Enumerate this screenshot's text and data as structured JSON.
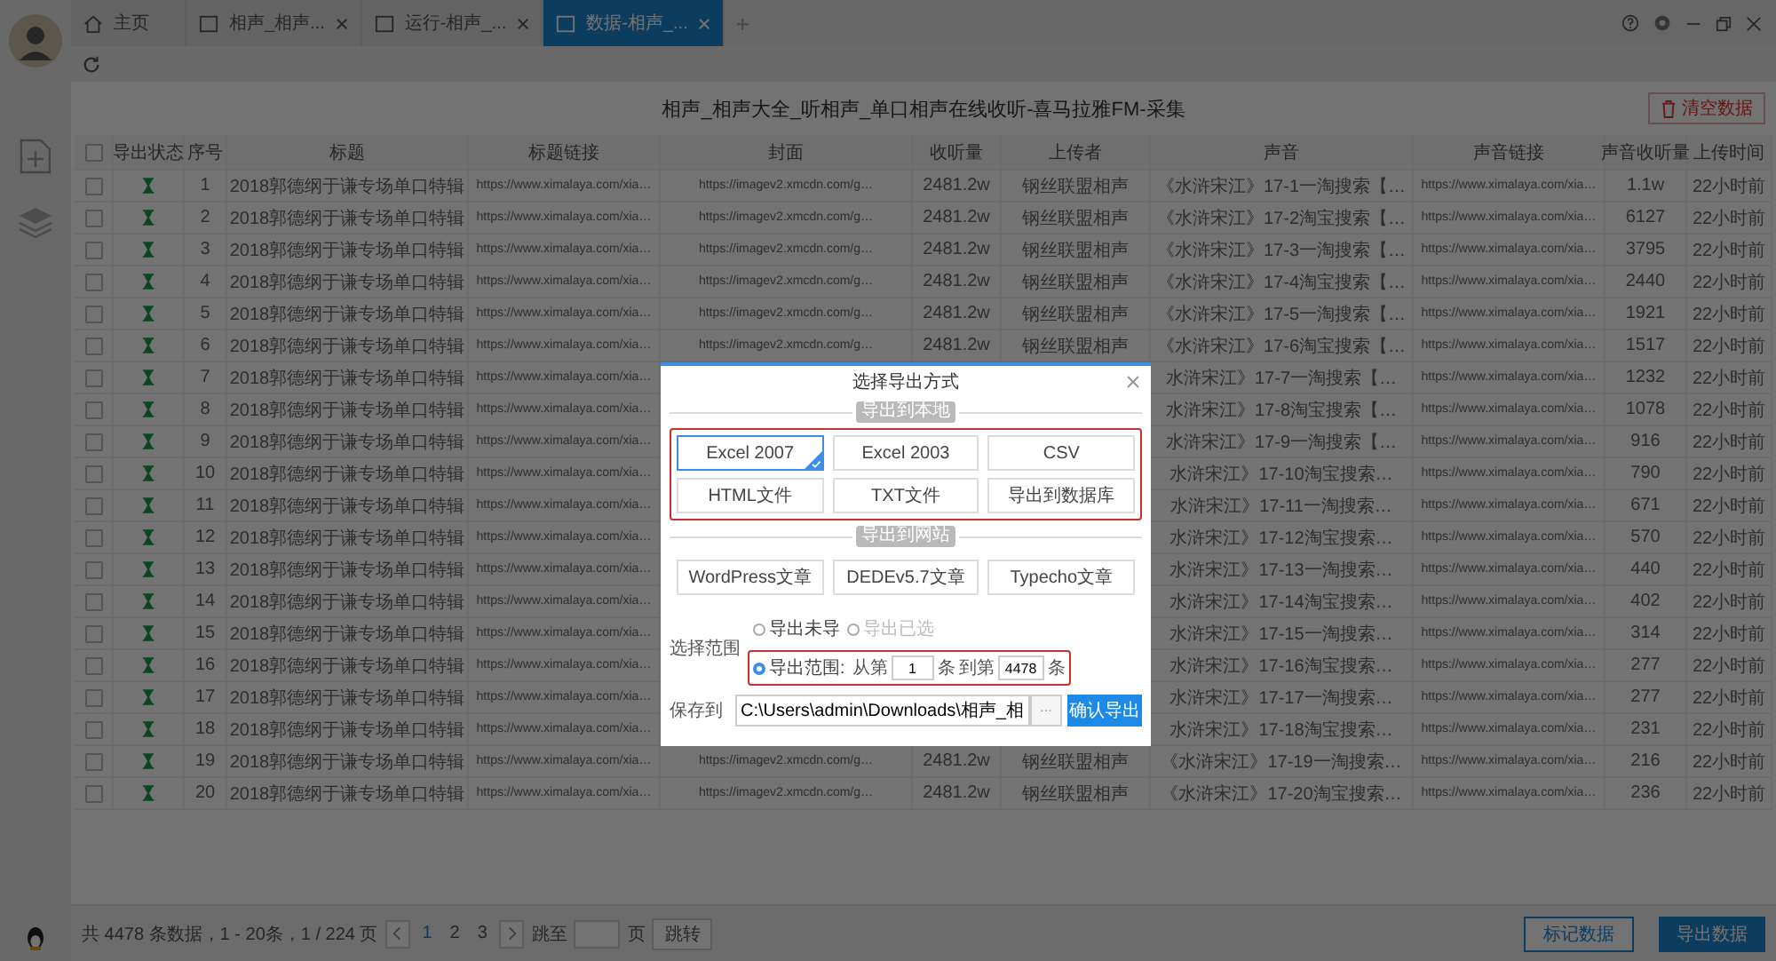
{
  "tabs": [
    {
      "label": "主页",
      "kind": "home",
      "selected": false,
      "closable": false
    },
    {
      "label": "相声_相声...",
      "kind": "page",
      "selected": false,
      "closable": true
    },
    {
      "label": "运行-相声_...",
      "kind": "page",
      "selected": false,
      "closable": true
    },
    {
      "label": "数据-相声_...",
      "kind": "page",
      "selected": true,
      "closable": true
    }
  ],
  "add_tab": "+",
  "page_title": "相声_相声大全_听相声_单口相声在线收听-喜马拉雅FM-采集",
  "clear_button": "清空数据",
  "table": {
    "header_checked": false,
    "status_header": "导出状态",
    "columns": [
      "序号",
      "标题",
      "标题链接",
      "封面",
      "收听量",
      "上传者",
      "声音",
      "声音链接",
      "声音收听量",
      "上传时间"
    ],
    "rows": [
      {
        "checked": false,
        "cells": [
          "1",
          "2018郭德纲于谦专场单口特辑",
          "https://www.ximalaya.com/xia…",
          "https://imagev2.xmcdn.com/g…",
          "2481.2w",
          "钢丝联盟相声",
          "《水浒宋江》17-1一淘搜索【…",
          "https://www.ximalaya.com/xia…",
          "1.1w",
          "22小时前"
        ]
      },
      {
        "checked": false,
        "cells": [
          "2",
          "2018郭德纲于谦专场单口特辑",
          "https://www.ximalaya.com/xia…",
          "https://imagev2.xmcdn.com/g…",
          "2481.2w",
          "钢丝联盟相声",
          "《水浒宋江》17-2淘宝搜索【…",
          "https://www.ximalaya.com/xia…",
          "6127",
          "22小时前"
        ]
      },
      {
        "checked": false,
        "cells": [
          "3",
          "2018郭德纲于谦专场单口特辑",
          "https://www.ximalaya.com/xia…",
          "https://imagev2.xmcdn.com/g…",
          "2481.2w",
          "钢丝联盟相声",
          "《水浒宋江》17-3一淘搜索【…",
          "https://www.ximalaya.com/xia…",
          "3795",
          "22小时前"
        ]
      },
      {
        "checked": false,
        "cells": [
          "4",
          "2018郭德纲于谦专场单口特辑",
          "https://www.ximalaya.com/xia…",
          "https://imagev2.xmcdn.com/g…",
          "2481.2w",
          "钢丝联盟相声",
          "《水浒宋江》17-4淘宝搜索【…",
          "https://www.ximalaya.com/xia…",
          "2440",
          "22小时前"
        ]
      },
      {
        "checked": false,
        "cells": [
          "5",
          "2018郭德纲于谦专场单口特辑",
          "https://www.ximalaya.com/xia…",
          "https://imagev2.xmcdn.com/g…",
          "2481.2w",
          "钢丝联盟相声",
          "《水浒宋江》17-5一淘搜索【…",
          "https://www.ximalaya.com/xia…",
          "1921",
          "22小时前"
        ]
      },
      {
        "checked": false,
        "cells": [
          "6",
          "2018郭德纲于谦专场单口特辑",
          "https://www.ximalaya.com/xia…",
          "https://imagev2.xmcdn.com/g…",
          "2481.2w",
          "钢丝联盟相声",
          "《水浒宋江》17-6淘宝搜索【…",
          "https://www.ximalaya.com/xia…",
          "1517",
          "22小时前"
        ]
      },
      {
        "checked": false,
        "cells": [
          "7",
          "2018郭德纲于谦专场单口特辑",
          "https://www.ximalaya.com/xia…",
          null,
          null,
          null,
          "水浒宋江》17-7一淘搜索【…",
          "https://www.ximalaya.com/xia…",
          "1232",
          "22小时前"
        ]
      },
      {
        "checked": false,
        "cells": [
          "8",
          "2018郭德纲于谦专场单口特辑",
          "https://www.ximalaya.com/xia…",
          null,
          null,
          null,
          "水浒宋江》17-8淘宝搜索【…",
          "https://www.ximalaya.com/xia…",
          "1078",
          "22小时前"
        ]
      },
      {
        "checked": false,
        "cells": [
          "9",
          "2018郭德纲于谦专场单口特辑",
          "https://www.ximalaya.com/xia…",
          null,
          null,
          null,
          "水浒宋江》17-9一淘搜索【…",
          "https://www.ximalaya.com/xia…",
          "916",
          "22小时前"
        ]
      },
      {
        "checked": false,
        "cells": [
          "10",
          "2018郭德纲于谦专场单口特辑",
          "https://www.ximalaya.com/xia…",
          null,
          null,
          null,
          "水浒宋江》17-10淘宝搜索…",
          "https://www.ximalaya.com/xia…",
          "790",
          "22小时前"
        ]
      },
      {
        "checked": false,
        "cells": [
          "11",
          "2018郭德纲于谦专场单口特辑",
          "https://www.ximalaya.com/xia…",
          null,
          null,
          null,
          "水浒宋江》17-11一淘搜索…",
          "https://www.ximalaya.com/xia…",
          "671",
          "22小时前"
        ]
      },
      {
        "checked": false,
        "cells": [
          "12",
          "2018郭德纲于谦专场单口特辑",
          "https://www.ximalaya.com/xia…",
          null,
          null,
          null,
          "水浒宋江》17-12淘宝搜索…",
          "https://www.ximalaya.com/xia…",
          "570",
          "22小时前"
        ]
      },
      {
        "checked": false,
        "cells": [
          "13",
          "2018郭德纲于谦专场单口特辑",
          "https://www.ximalaya.com/xia…",
          null,
          null,
          null,
          "水浒宋江》17-13一淘搜索…",
          "https://www.ximalaya.com/xia…",
          "440",
          "22小时前"
        ]
      },
      {
        "checked": false,
        "cells": [
          "14",
          "2018郭德纲于谦专场单口特辑",
          "https://www.ximalaya.com/xia…",
          null,
          null,
          null,
          "水浒宋江》17-14淘宝搜索…",
          "https://www.ximalaya.com/xia…",
          "402",
          "22小时前"
        ]
      },
      {
        "checked": false,
        "cells": [
          "15",
          "2018郭德纲于谦专场单口特辑",
          "https://www.ximalaya.com/xia…",
          null,
          null,
          null,
          "水浒宋江》17-15一淘搜索…",
          "https://www.ximalaya.com/xia…",
          "314",
          "22小时前"
        ]
      },
      {
        "checked": false,
        "cells": [
          "16",
          "2018郭德纲于谦专场单口特辑",
          "https://www.ximalaya.com/xia…",
          null,
          null,
          null,
          "水浒宋江》17-16淘宝搜索…",
          "https://www.ximalaya.com/xia…",
          "277",
          "22小时前"
        ]
      },
      {
        "checked": false,
        "cells": [
          "17",
          "2018郭德纲于谦专场单口特辑",
          "https://www.ximalaya.com/xia…",
          null,
          null,
          null,
          "水浒宋江》17-17一淘搜索…",
          "https://www.ximalaya.com/xia…",
          "277",
          "22小时前"
        ]
      },
      {
        "checked": false,
        "cells": [
          "18",
          "2018郭德纲于谦专场单口特辑",
          "https://www.ximalaya.com/xia…",
          null,
          null,
          null,
          "水浒宋江》17-18淘宝搜索…",
          "https://www.ximalaya.com/xia…",
          "231",
          "22小时前"
        ]
      },
      {
        "checked": false,
        "cells": [
          "19",
          "2018郭德纲于谦专场单口特辑",
          "https://www.ximalaya.com/xia…",
          "https://imagev2.xmcdn.com/g…",
          "2481.2w",
          "钢丝联盟相声",
          "《水浒宋江》17-19一淘搜索…",
          "https://www.ximalaya.com/xia…",
          "216",
          "22小时前"
        ]
      },
      {
        "checked": false,
        "cells": [
          "20",
          "2018郭德纲于谦专场单口特辑",
          "https://www.ximalaya.com/xia…",
          "https://imagev2.xmcdn.com/g…",
          "2481.2w",
          "钢丝联盟相声",
          "《水浒宋江》17-20淘宝搜索…",
          "https://www.ximalaya.com/xia…",
          "236",
          "22小时前"
        ]
      }
    ]
  },
  "dialog": {
    "title": "选择导出方式",
    "sections": [
      {
        "label": "导出到本地",
        "highlighted": true,
        "options": [
          {
            "label": "Excel 2007",
            "selected": true
          },
          {
            "label": "Excel 2003",
            "selected": false
          },
          {
            "label": "CSV",
            "selected": false
          },
          {
            "label": "HTML文件",
            "selected": false
          },
          {
            "label": "TXT文件",
            "selected": false
          },
          {
            "label": "导出到数据库",
            "selected": false
          }
        ]
      },
      {
        "label": "导出到网站",
        "highlighted": false,
        "options": [
          {
            "label": "WordPress文章",
            "selected": false
          },
          {
            "label": "DEDEv5.7文章",
            "selected": false
          },
          {
            "label": "Typecho文章",
            "selected": false
          }
        ]
      }
    ],
    "range_label": "选择范围",
    "range_options": [
      {
        "label": "导出未导",
        "selected": false,
        "disabled": false
      },
      {
        "label": "导出已选",
        "selected": false,
        "disabled": true
      },
      {
        "label": "导出范围:",
        "selected": true,
        "disabled": false
      }
    ],
    "range_highlighted": true,
    "from_label": "从第",
    "from_value": "1",
    "from_unit": "条",
    "to_label": "到第",
    "to_value": "4478",
    "to_unit": "条",
    "save_label": "保存到",
    "save_path": "C:\\Users\\admin\\Downloads\\相声_相",
    "browse": "···",
    "confirm": "确认导出"
  },
  "footer": {
    "summary": "共 4478 条数据，1 - 20条，1 / 224 页",
    "pages": [
      {
        "label": "1",
        "selected": true
      },
      {
        "label": "2",
        "selected": false
      },
      {
        "label": "3",
        "selected": false
      }
    ],
    "goto_label": "跳至",
    "goto_unit": "页",
    "goto_button": "跳转",
    "mark_button": "标记数据",
    "export_button": "导出数据"
  }
}
